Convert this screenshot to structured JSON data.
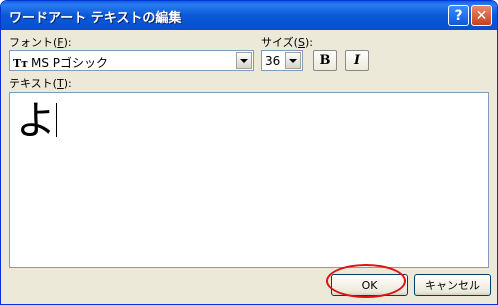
{
  "window": {
    "title": "ワードアート テキストの編集",
    "help_glyph": "?",
    "close_glyph": "✕"
  },
  "font": {
    "label_prefix": "フォント(",
    "label_key": "F",
    "label_suffix": "):",
    "value": "MS Pゴシック",
    "icon": "truetype-font-icon"
  },
  "size": {
    "label_prefix": "サイズ(",
    "label_key": "S",
    "label_suffix": "):",
    "value": "36"
  },
  "format_buttons": {
    "bold_label": "B",
    "italic_label": "I"
  },
  "text": {
    "label_prefix": "テキスト(",
    "label_key": "T",
    "label_suffix": "):",
    "content": "よ"
  },
  "buttons": {
    "ok_label": "OK",
    "cancel_label": "キャンセル"
  },
  "colors": {
    "titlebar": "#0b58d8",
    "highlight": "#e01010"
  }
}
